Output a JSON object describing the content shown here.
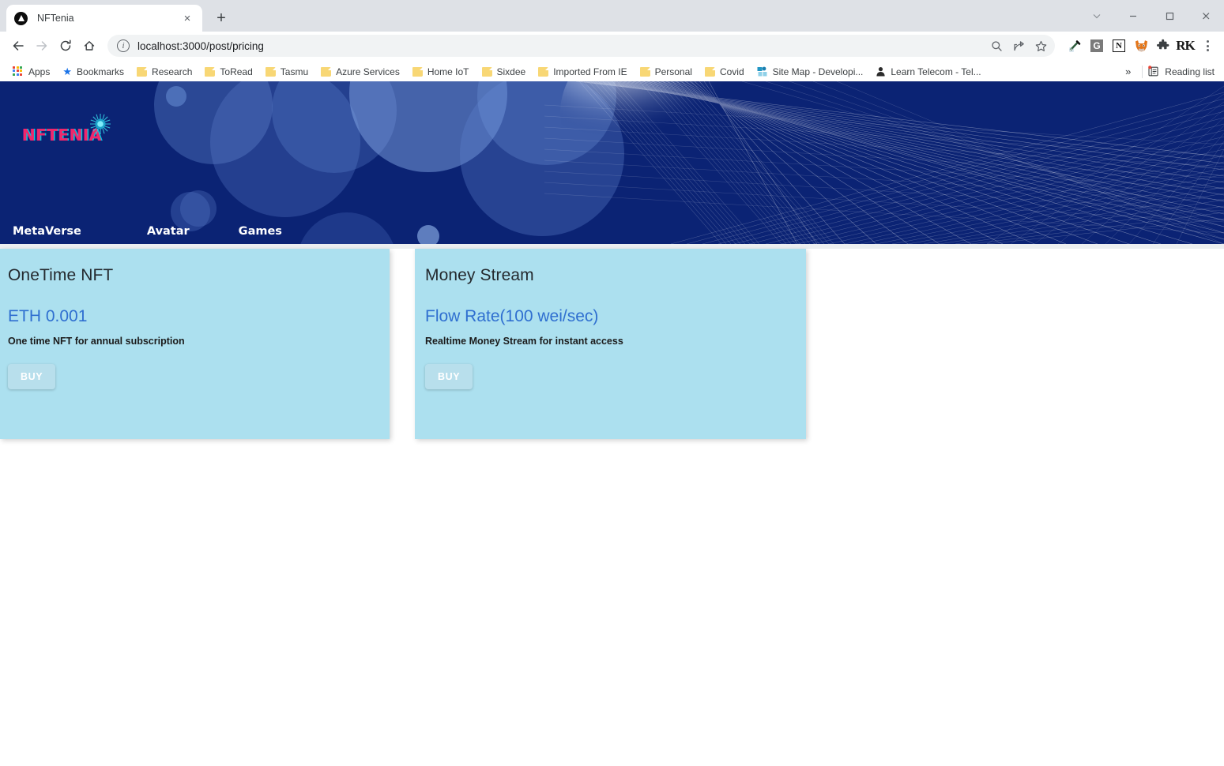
{
  "browser": {
    "tab": {
      "title": "NFTenia",
      "favicon_name": "vercel-triangle-icon",
      "close_label": "×"
    },
    "new_tab_label": "+",
    "window_controls": [
      {
        "name": "chevron-down-button",
        "label": "⌄"
      },
      {
        "name": "minimize-button",
        "label": "–"
      },
      {
        "name": "maximize-button",
        "label": "□"
      },
      {
        "name": "close-button",
        "label": "×"
      }
    ],
    "nav": {
      "back_label": "←",
      "forward_label": "→",
      "reload_label": "↻",
      "home_label": "⌂"
    },
    "omnibox": {
      "url": "localhost:3000/post/pricing",
      "placeholder": "Search Google or type a URL",
      "info_label": "i",
      "actions": [
        "zoom-search-icon",
        "share-icon",
        "bookmark-star-icon"
      ]
    },
    "extensions": [
      {
        "name": "eyedropper-icon",
        "label": ""
      },
      {
        "name": "grammarly-icon",
        "label": "G"
      },
      {
        "name": "notion-icon",
        "label": "N"
      },
      {
        "name": "metamask-icon",
        "label": ""
      },
      {
        "name": "extensions-puzzle-icon",
        "label": ""
      },
      {
        "name": "rx-extension-icon",
        "label": "RK"
      }
    ],
    "menu_label": "⋮",
    "bookmarks": [
      {
        "label": "Apps",
        "icon": "apps-grid-icon"
      },
      {
        "label": "Bookmarks",
        "icon": "star-icon"
      },
      {
        "label": "Research",
        "icon": "folder-icon"
      },
      {
        "label": "ToRead",
        "icon": "folder-icon"
      },
      {
        "label": "Tasmu",
        "icon": "folder-icon"
      },
      {
        "label": "Azure Services",
        "icon": "folder-icon"
      },
      {
        "label": "Home IoT",
        "icon": "folder-icon"
      },
      {
        "label": "Sixdee",
        "icon": "folder-icon"
      },
      {
        "label": "Imported From IE",
        "icon": "folder-icon"
      },
      {
        "label": "Personal",
        "icon": "folder-icon"
      },
      {
        "label": "Covid",
        "icon": "folder-icon"
      },
      {
        "label": "Site Map - Developi...",
        "icon": "sitemap-favicon"
      },
      {
        "label": "Learn Telecom - Tel...",
        "icon": "person-favicon"
      }
    ],
    "bookmarks_overflow_label": "»",
    "reading_list_label": "Reading list"
  },
  "page": {
    "hero": {
      "logo_text": "NFTENIA",
      "logo_star_name": "starburst-icon",
      "nav": [
        {
          "label": "MetaVerse"
        },
        {
          "label": "Avatar"
        },
        {
          "label": "Games"
        }
      ]
    },
    "pricing_cards": [
      {
        "title": "OneTime NFT",
        "price": "ETH 0.001",
        "description": "One time NFT for annual subscription",
        "button": "BUY"
      },
      {
        "title": "Money Stream",
        "price": "Flow Rate(100 wei/sec)",
        "description": "Realtime Money Stream for instant access",
        "button": "BUY"
      }
    ]
  },
  "colors": {
    "hero_bg": "#0b2374",
    "card_bg": "#ace0ef",
    "price_blue": "#2f6fd0",
    "logo_pink": "#f0276b",
    "logo_cyan": "#22d3ee",
    "page_bg": "#ffffff"
  }
}
